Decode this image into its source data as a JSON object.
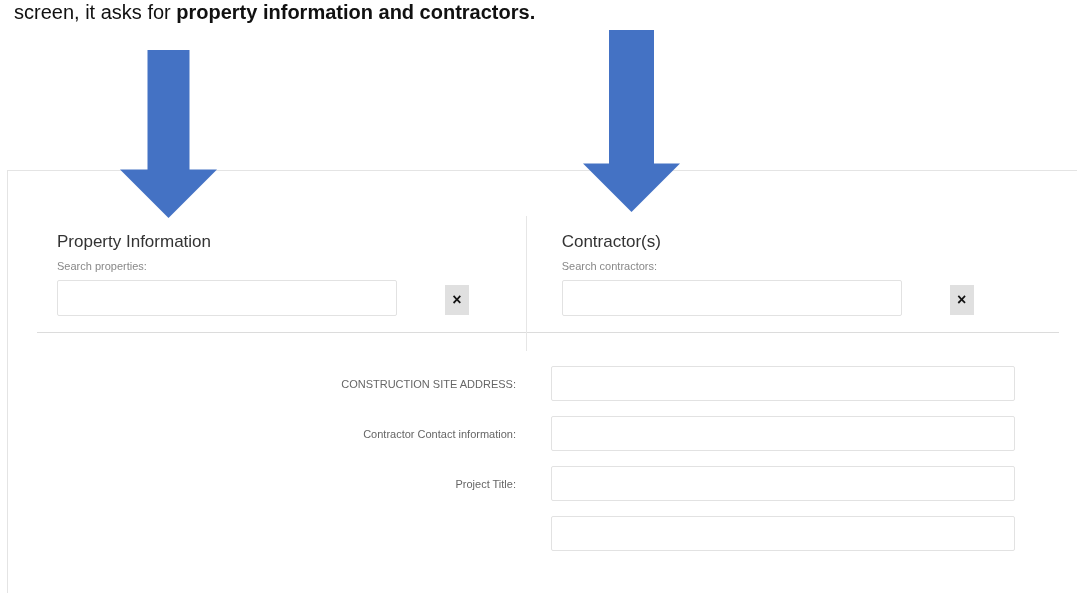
{
  "caption": "screen, it asks for **property information and contractors.**",
  "search_panels": [
    {
      "title": "Property Information",
      "label": "Search properties:",
      "clear_button": "×"
    },
    {
      "title": "Contractor(s)",
      "label": "Search contractors:",
      "clear_button": "×"
    }
  ],
  "fields": [
    {
      "kind": "labeled",
      "label": "CONSTRUCTION SITE ADDRESS:"
    },
    {
      "kind": "labeled",
      "label": "Contractor Contact information:"
    },
    {
      "kind": "labeled",
      "label": "Project Title:"
    },
    {
      "kind": "cut"
    }
  ]
}
